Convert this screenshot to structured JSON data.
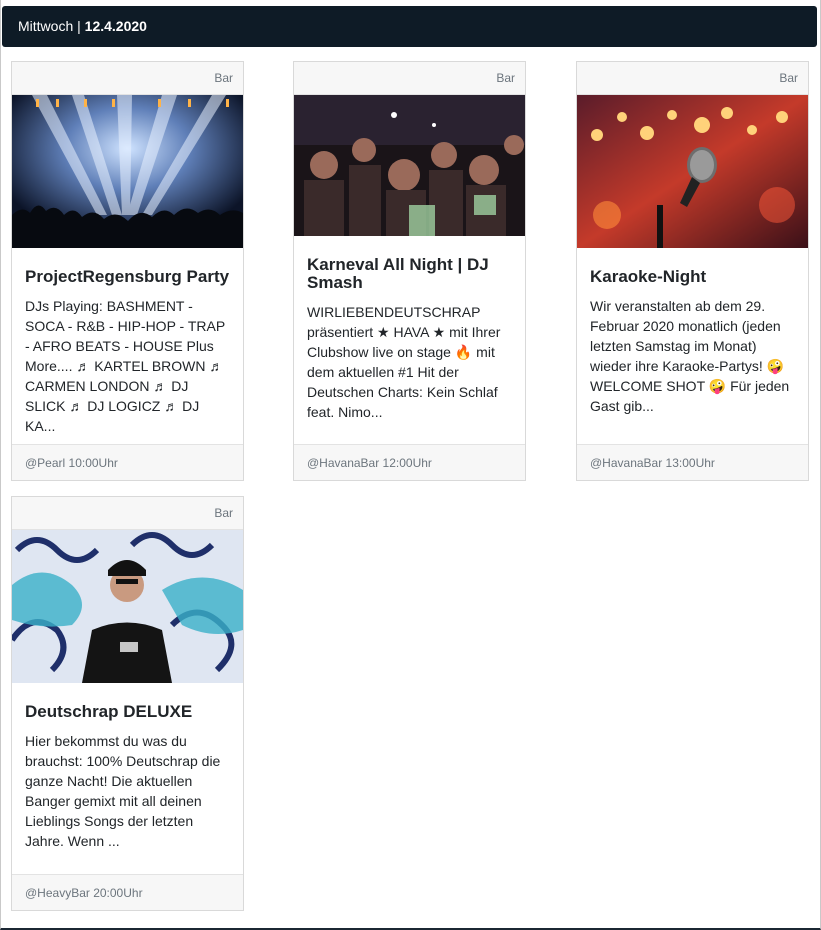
{
  "header": {
    "weekday": "Mittwoch",
    "separator": "|",
    "date": "12.4.2020"
  },
  "cards": [
    {
      "category": "Bar",
      "image": "concert-stage-lights-image",
      "title": "ProjectRegensburg Party",
      "text": "DJs Playing: BASHMENT - SOCA - R&B - HIP-HOP - TRAP - AFRO BEATS - HOUSE Plus More.... ♬ KARTEL BROWN ♬ CARMEN LONDON ♬ DJ SLICK ♬ DJ LOGICZ ♬ DJ KA...",
      "footer": "@Pearl 10:00Uhr"
    },
    {
      "category": "Bar",
      "image": "party-crowd-image",
      "title": "Karneval All Night | DJ Smash",
      "text": "WIRLIEBENDEUTSCHRAP präsentiert ★ HAVA ★ mit Ihrer Clubshow live on stage 🔥 mit dem aktuellen #1 Hit der Deutschen Charts: Kein Schlaf feat. Nimo...",
      "footer": "@HavanaBar 12:00Uhr"
    },
    {
      "category": "Bar",
      "image": "karaoke-microphone-image",
      "title": "Karaoke-Night",
      "text": "Wir veranstalten ab dem 29. Februar 2020 monatlich (jeden letzten Samstag im Monat) wieder ihre Karaoke-Partys! 🤪 WELCOME SHOT 🤪 Für jeden Gast gib...",
      "footer": "@HavanaBar 13:00Uhr"
    },
    {
      "category": "Bar",
      "image": "rapper-graffiti-image",
      "title": "Deutschrap DELUXE",
      "text": "Hier bekommst du was du brauchst: 100% Deutschrap die ganze Nacht! Die aktuellen Banger gemixt mit all deinen Lieblings Songs der letzten Jahre. Wenn ...",
      "footer": "@HeavyBar 20:00Uhr"
    }
  ]
}
